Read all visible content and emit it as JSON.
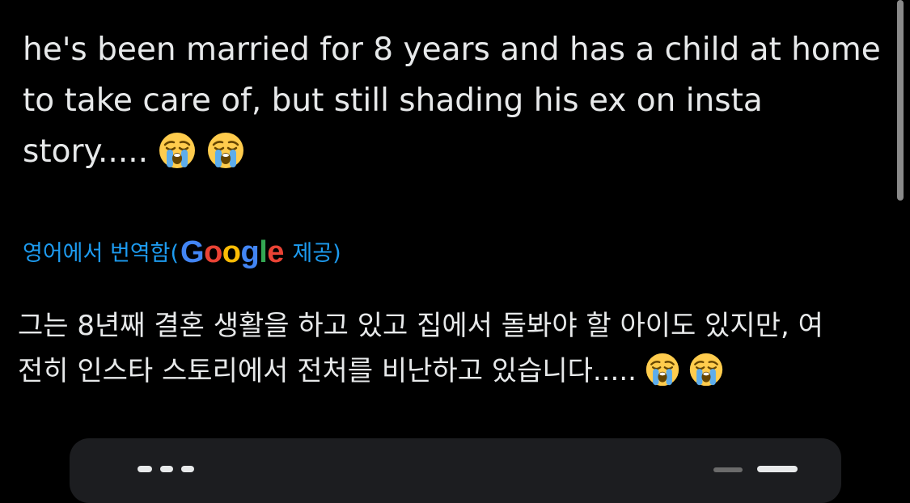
{
  "post": {
    "lines": [
      "he's been married for 8 years and has a child at home",
      "to take care of, but still shading his ex on insta",
      "story....."
    ],
    "emojis": [
      "loudly-crying-face",
      "loudly-crying-face"
    ]
  },
  "translation": {
    "prefix": "영어에서 번역함(",
    "google_letters": [
      "G",
      "o",
      "o",
      "g",
      "l",
      "e"
    ],
    "suffix": " 제공)",
    "lines": [
      "그는 8년째 결혼 생활을 하고 있고 집에서 돌봐야 할 아이도 있지만, 여",
      "전히 인스타 스토리에서 전처를 비난하고 있습니다....."
    ],
    "emojis": [
      "loudly-crying-face",
      "loudly-crying-face"
    ]
  },
  "colors": {
    "background": "#000000",
    "text": "#e7e9ea",
    "link": "#1d9bf0",
    "google_blue": "#4285f4",
    "google_red": "#ea4335",
    "google_yellow": "#fbbc05",
    "google_green": "#34a853",
    "card": "#1c1d20"
  }
}
